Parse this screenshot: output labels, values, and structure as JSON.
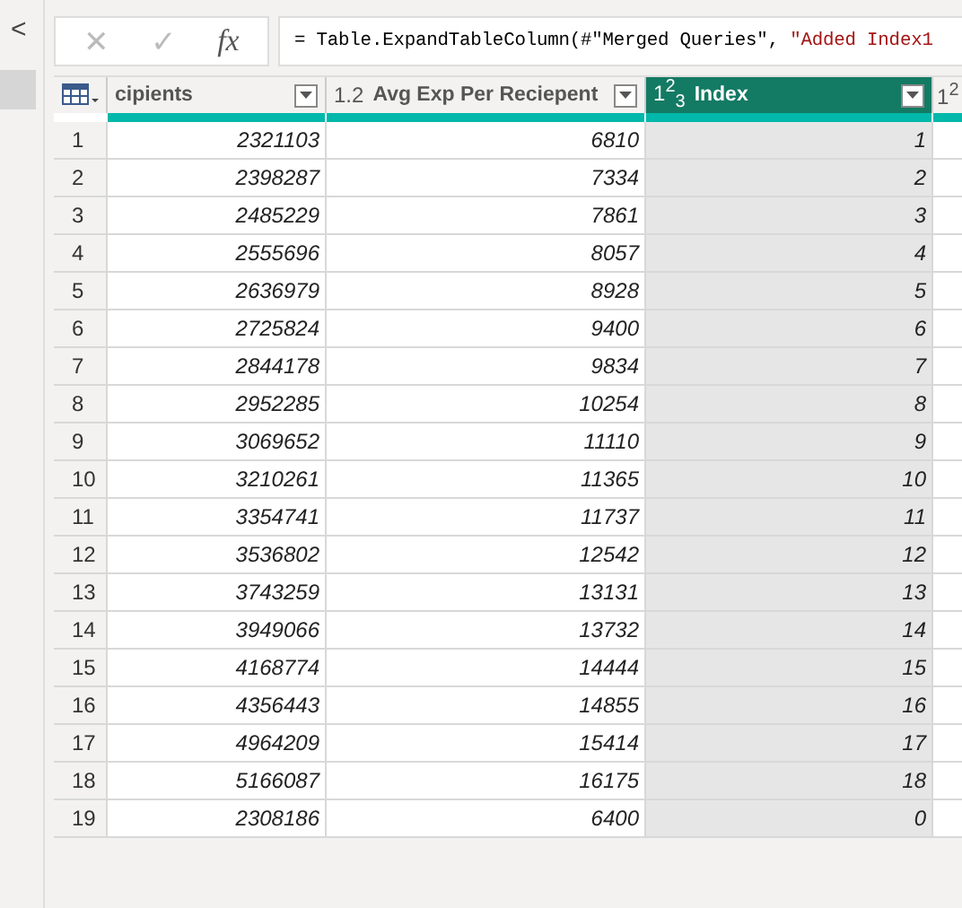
{
  "sidebar": {
    "collapse_icon": "<"
  },
  "formula_bar": {
    "cancel": "✕",
    "confirm": "✓",
    "fx": "fx",
    "formula": "= Table.ExpandTableColumn(#\"Merged Queries\", ",
    "formula_string": "\"Added Index1"
  },
  "table": {
    "columns": [
      {
        "name": "cipients",
        "selected": false
      },
      {
        "type": "1.2",
        "name": "Avg Exp Per Reciepent",
        "selected": false
      },
      {
        "type": "1$^{2}$$_{3}$",
        "name": "Index",
        "selected": true
      },
      {
        "type": "1$^{2}$",
        "selected": false
      }
    ],
    "rows": [
      [
        "1",
        "2321103",
        "6810",
        "1"
      ],
      [
        "2",
        "2398287",
        "7334",
        "2"
      ],
      [
        "3",
        "2485229",
        "7861",
        "3"
      ],
      [
        "4",
        "2555696",
        "8057",
        "4"
      ],
      [
        "5",
        "2636979",
        "8928",
        "5"
      ],
      [
        "6",
        "2725824",
        "9400",
        "6"
      ],
      [
        "7",
        "2844178",
        "9834",
        "7"
      ],
      [
        "8",
        "2952285",
        "10254",
        "8"
      ],
      [
        "9",
        "3069652",
        "11110",
        "9"
      ],
      [
        "10",
        "3210261",
        "11365",
        "10"
      ],
      [
        "11",
        "3354741",
        "11737",
        "11"
      ],
      [
        "12",
        "3536802",
        "12542",
        "12"
      ],
      [
        "13",
        "3743259",
        "13131",
        "13"
      ],
      [
        "14",
        "3949066",
        "13732",
        "14"
      ],
      [
        "15",
        "4168774",
        "14444",
        "15"
      ],
      [
        "16",
        "4356443",
        "14855",
        "16"
      ],
      [
        "17",
        "4964209",
        "15414",
        "17"
      ],
      [
        "18",
        "5166087",
        "16175",
        "18"
      ],
      [
        "19",
        "2308186",
        "6400",
        "0"
      ]
    ]
  }
}
